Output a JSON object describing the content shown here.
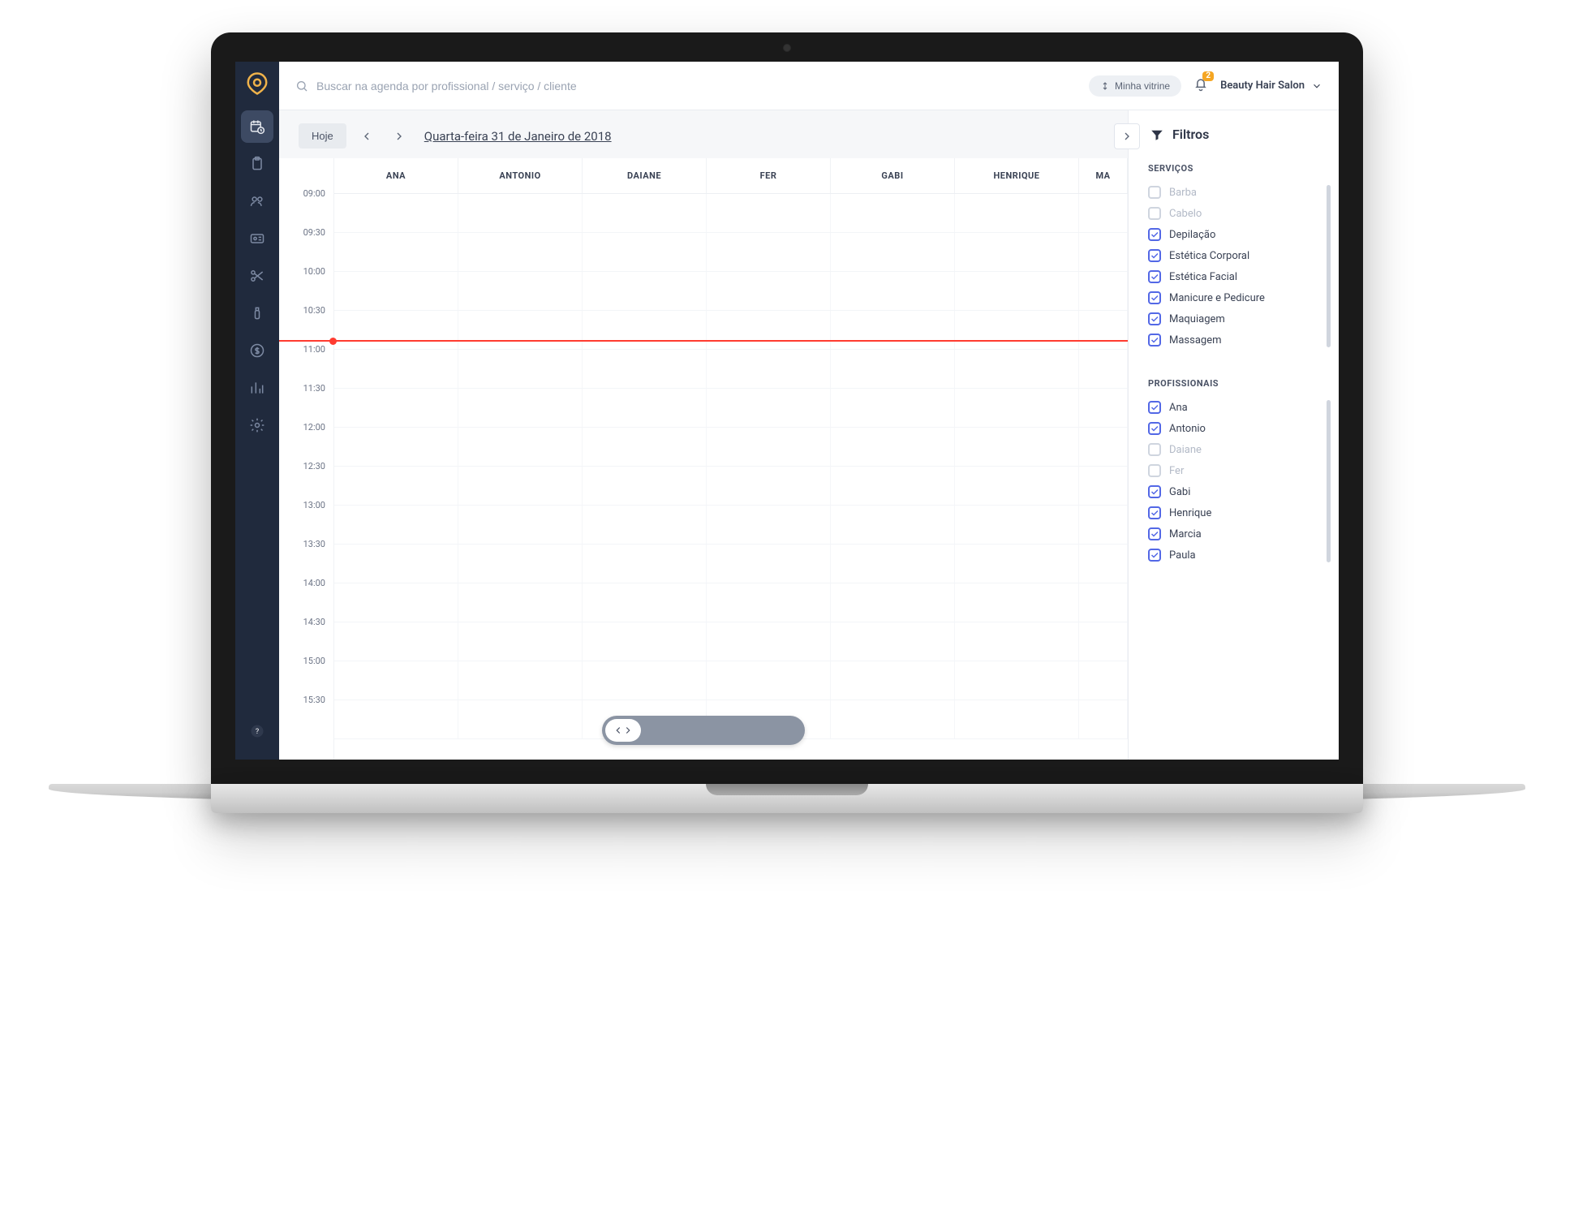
{
  "header": {
    "search_placeholder": "Buscar na agenda por profissional / serviço / cliente",
    "vitrine_label": "Minha vitrine",
    "notification_count": "2",
    "salon_name": "Beauty Hair Salon"
  },
  "sidebar": {
    "items": [
      {
        "name": "agenda",
        "active": true
      },
      {
        "name": "clipboard"
      },
      {
        "name": "clients"
      },
      {
        "name": "professionals"
      },
      {
        "name": "services"
      },
      {
        "name": "products"
      },
      {
        "name": "financial"
      },
      {
        "name": "reports"
      },
      {
        "name": "settings"
      }
    ]
  },
  "datebar": {
    "today_label": "Hoje",
    "date_label": "Quarta-feira 31 de Janeiro de 2018"
  },
  "calendar": {
    "columns": [
      "ANA",
      "ANTONIO",
      "DAIANE",
      "FER",
      "GABI",
      "HENRIQUE",
      "MA"
    ],
    "time_slots": [
      "09:00",
      "09:30",
      "10:00",
      "10:30",
      "11:00",
      "11:30",
      "12:00",
      "12:30",
      "13:00",
      "13:30",
      "14:00",
      "14:30",
      "15:00",
      "15:30"
    ],
    "now_index": 3.75
  },
  "filters": {
    "title": "Filtros",
    "sections": {
      "services": {
        "title": "SERVIÇOS",
        "items": [
          {
            "label": "Barba",
            "checked": false
          },
          {
            "label": "Cabelo",
            "checked": false
          },
          {
            "label": "Depilação",
            "checked": true
          },
          {
            "label": "Estética Corporal",
            "checked": true
          },
          {
            "label": "Estética Facial",
            "checked": true
          },
          {
            "label": "Manicure e Pedicure",
            "checked": true
          },
          {
            "label": "Maquiagem",
            "checked": true
          },
          {
            "label": "Massagem",
            "checked": true
          }
        ]
      },
      "professionals": {
        "title": "PROFISSIONAIS",
        "items": [
          {
            "label": "Ana",
            "checked": true
          },
          {
            "label": "Antonio",
            "checked": true
          },
          {
            "label": "Daiane",
            "checked": false
          },
          {
            "label": "Fer",
            "checked": false
          },
          {
            "label": "Gabi",
            "checked": true
          },
          {
            "label": "Henrique",
            "checked": true
          },
          {
            "label": "Marcia",
            "checked": true
          },
          {
            "label": "Paula",
            "checked": true
          }
        ]
      }
    }
  },
  "colors": {
    "accent": "#5368e6",
    "sidebar_bg": "#202a3d",
    "now_line": "#ff3b30",
    "badge": "#f5a623"
  }
}
